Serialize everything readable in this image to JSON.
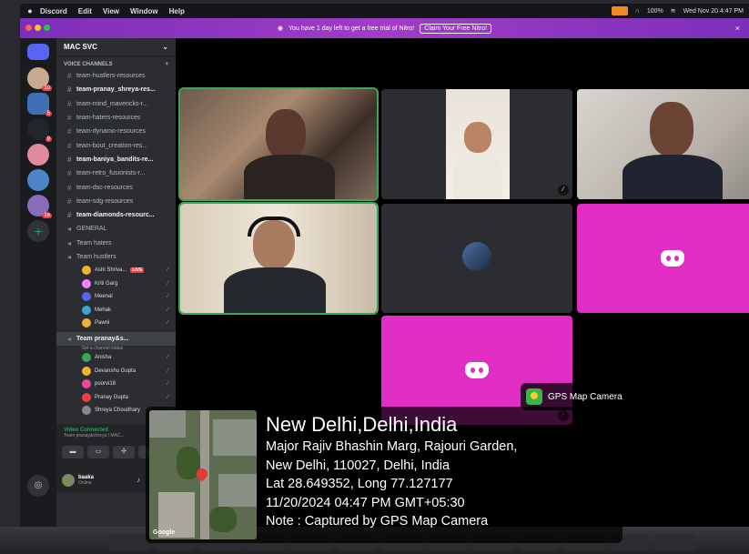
{
  "menubar": {
    "apple": "",
    "menus": [
      "Discord",
      "Edit",
      "View",
      "Window",
      "Help"
    ],
    "clock": "Wed Nov 20  4:47 PM",
    "battery": "100%"
  },
  "nitro_banner": {
    "text": "You have 1 day left to get a free trial of Nitro!",
    "button": "Claim Your Free Nitro!",
    "close": "×"
  },
  "server_rail": {
    "badges": [
      "10",
      "5",
      "9",
      "16"
    ]
  },
  "sidebar": {
    "server_name": "MAC SVC",
    "section_header": "VOICE CHANNELS",
    "channels": [
      {
        "name": "team-hustlers-resources",
        "bold": false
      },
      {
        "name": "team-pranay_shreya-res...",
        "bold": true
      },
      {
        "name": "team-mind_mavericks-r...",
        "bold": false
      },
      {
        "name": "team-haters-resources",
        "bold": false
      },
      {
        "name": "team-dynamo-resources",
        "bold": false
      },
      {
        "name": "team-bout_creation-res...",
        "bold": false
      },
      {
        "name": "team-baniya_bandits-re...",
        "bold": true
      },
      {
        "name": "team-retro_fusionists-r...",
        "bold": false
      },
      {
        "name": "team-dsc-resources",
        "bold": false
      },
      {
        "name": "team-sdg-resources",
        "bold": false
      },
      {
        "name": "team-diamonds-resourc...",
        "bold": true
      }
    ],
    "voice_channels": [
      "GENERAL",
      "Team haters",
      "Team hustlers"
    ],
    "hustlers_members": [
      {
        "name": "Ashi Shriva...",
        "live": "LIVE",
        "color": "#f0b232"
      },
      {
        "name": "Kriti Garg",
        "color": "#f47fff"
      },
      {
        "name": "Meenal",
        "color": "#5865f2"
      },
      {
        "name": "Mehak",
        "color": "#3ba5d8"
      },
      {
        "name": "Pawni",
        "color": "#f0b232"
      }
    ],
    "active_channel": "Team pranay&s...",
    "channel_status": "Set a channel status",
    "pranay_members": [
      {
        "name": "Anisha",
        "color": "#3ba55d"
      },
      {
        "name": "Devanshu Gupta",
        "color": "#f0b232"
      },
      {
        "name": "poorvi18",
        "color": "#eb459e"
      },
      {
        "name": "Pranay Gupta",
        "color": "#ed4245"
      },
      {
        "name": "Shreya Choudhary",
        "color": "#888888"
      }
    ],
    "voice_connected": "Video Connected",
    "voice_sub": "Team pranay&shreya / MAC...",
    "user_name": "baaka",
    "user_status": "Online"
  },
  "gps": {
    "app_name": "GPS Map Camera",
    "map_logo": "Google",
    "city": "New Delhi,Delhi,India",
    "address_1": "Major Rajiv Bhashin Marg, Rajouri Garden,",
    "address_2": "New Delhi, 110027, Delhi, India",
    "coords": "Lat 28.649352, Long 77.127177",
    "datetime": "11/20/2024 04:47 PM GMT+05:30",
    "note": "Note : Captured by GPS Map Camera"
  },
  "colors": {
    "accent_pink": "#e02ec4",
    "speaking_green": "#3ba55d",
    "nitro_purple": "#8b2fb8"
  }
}
